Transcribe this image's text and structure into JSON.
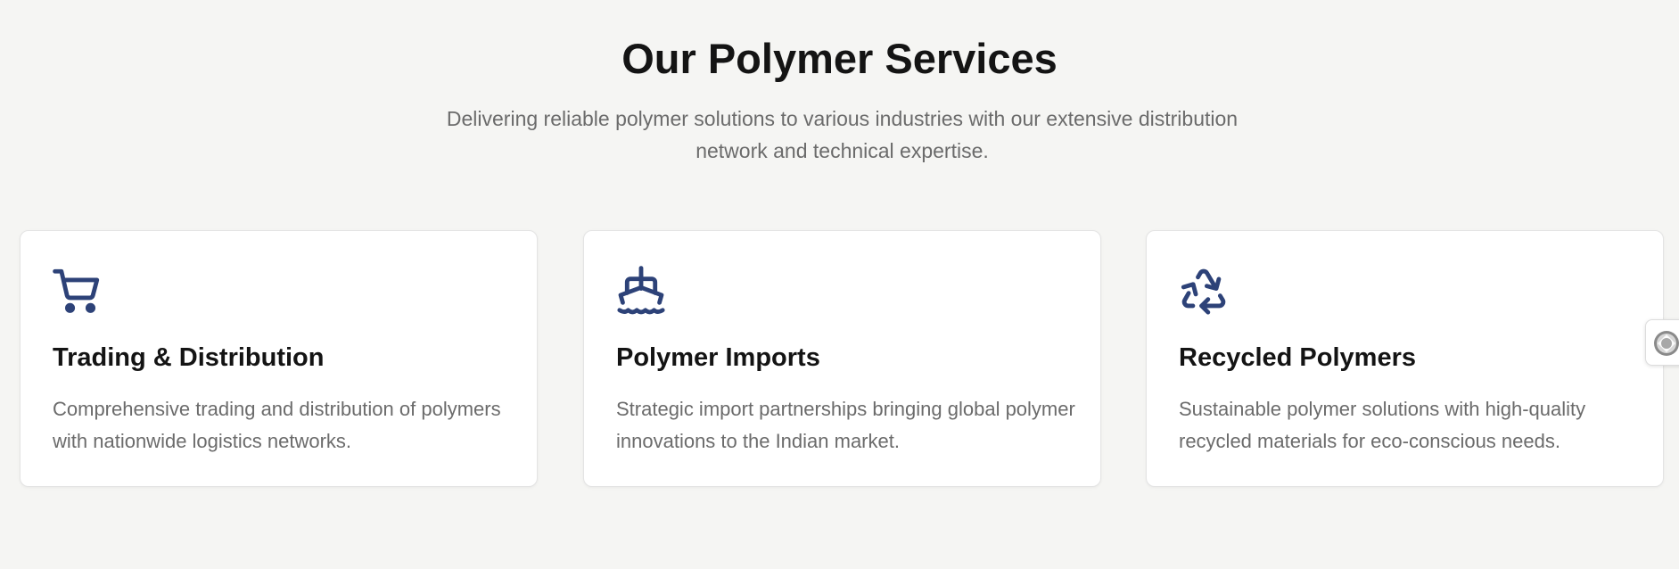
{
  "header": {
    "title": "Our Polymer Services",
    "subtitle": "Delivering reliable polymer solutions to various industries with our extensive distribution network and technical expertise."
  },
  "theme": {
    "background": "#f5f5f3",
    "card_background": "#ffffff",
    "icon_color": "#2d4278",
    "title_color": "#141414",
    "text_color": "#6b6b6b"
  },
  "services": [
    {
      "icon": "shopping-cart-icon",
      "title": "Trading & Distribution",
      "description": "Comprehensive trading and distribution of polymers with nationwide logistics networks."
    },
    {
      "icon": "ship-icon",
      "title": "Polymer Imports",
      "description": "Strategic import partnerships bringing global polymer innovations to the Indian market."
    },
    {
      "icon": "recycle-icon",
      "title": "Recycled Polymers",
      "description": "Sustainable polymer solutions with high-quality recycled materials for eco-conscious needs."
    }
  ],
  "side_widget": {
    "icon": "floating-widget-icon"
  }
}
